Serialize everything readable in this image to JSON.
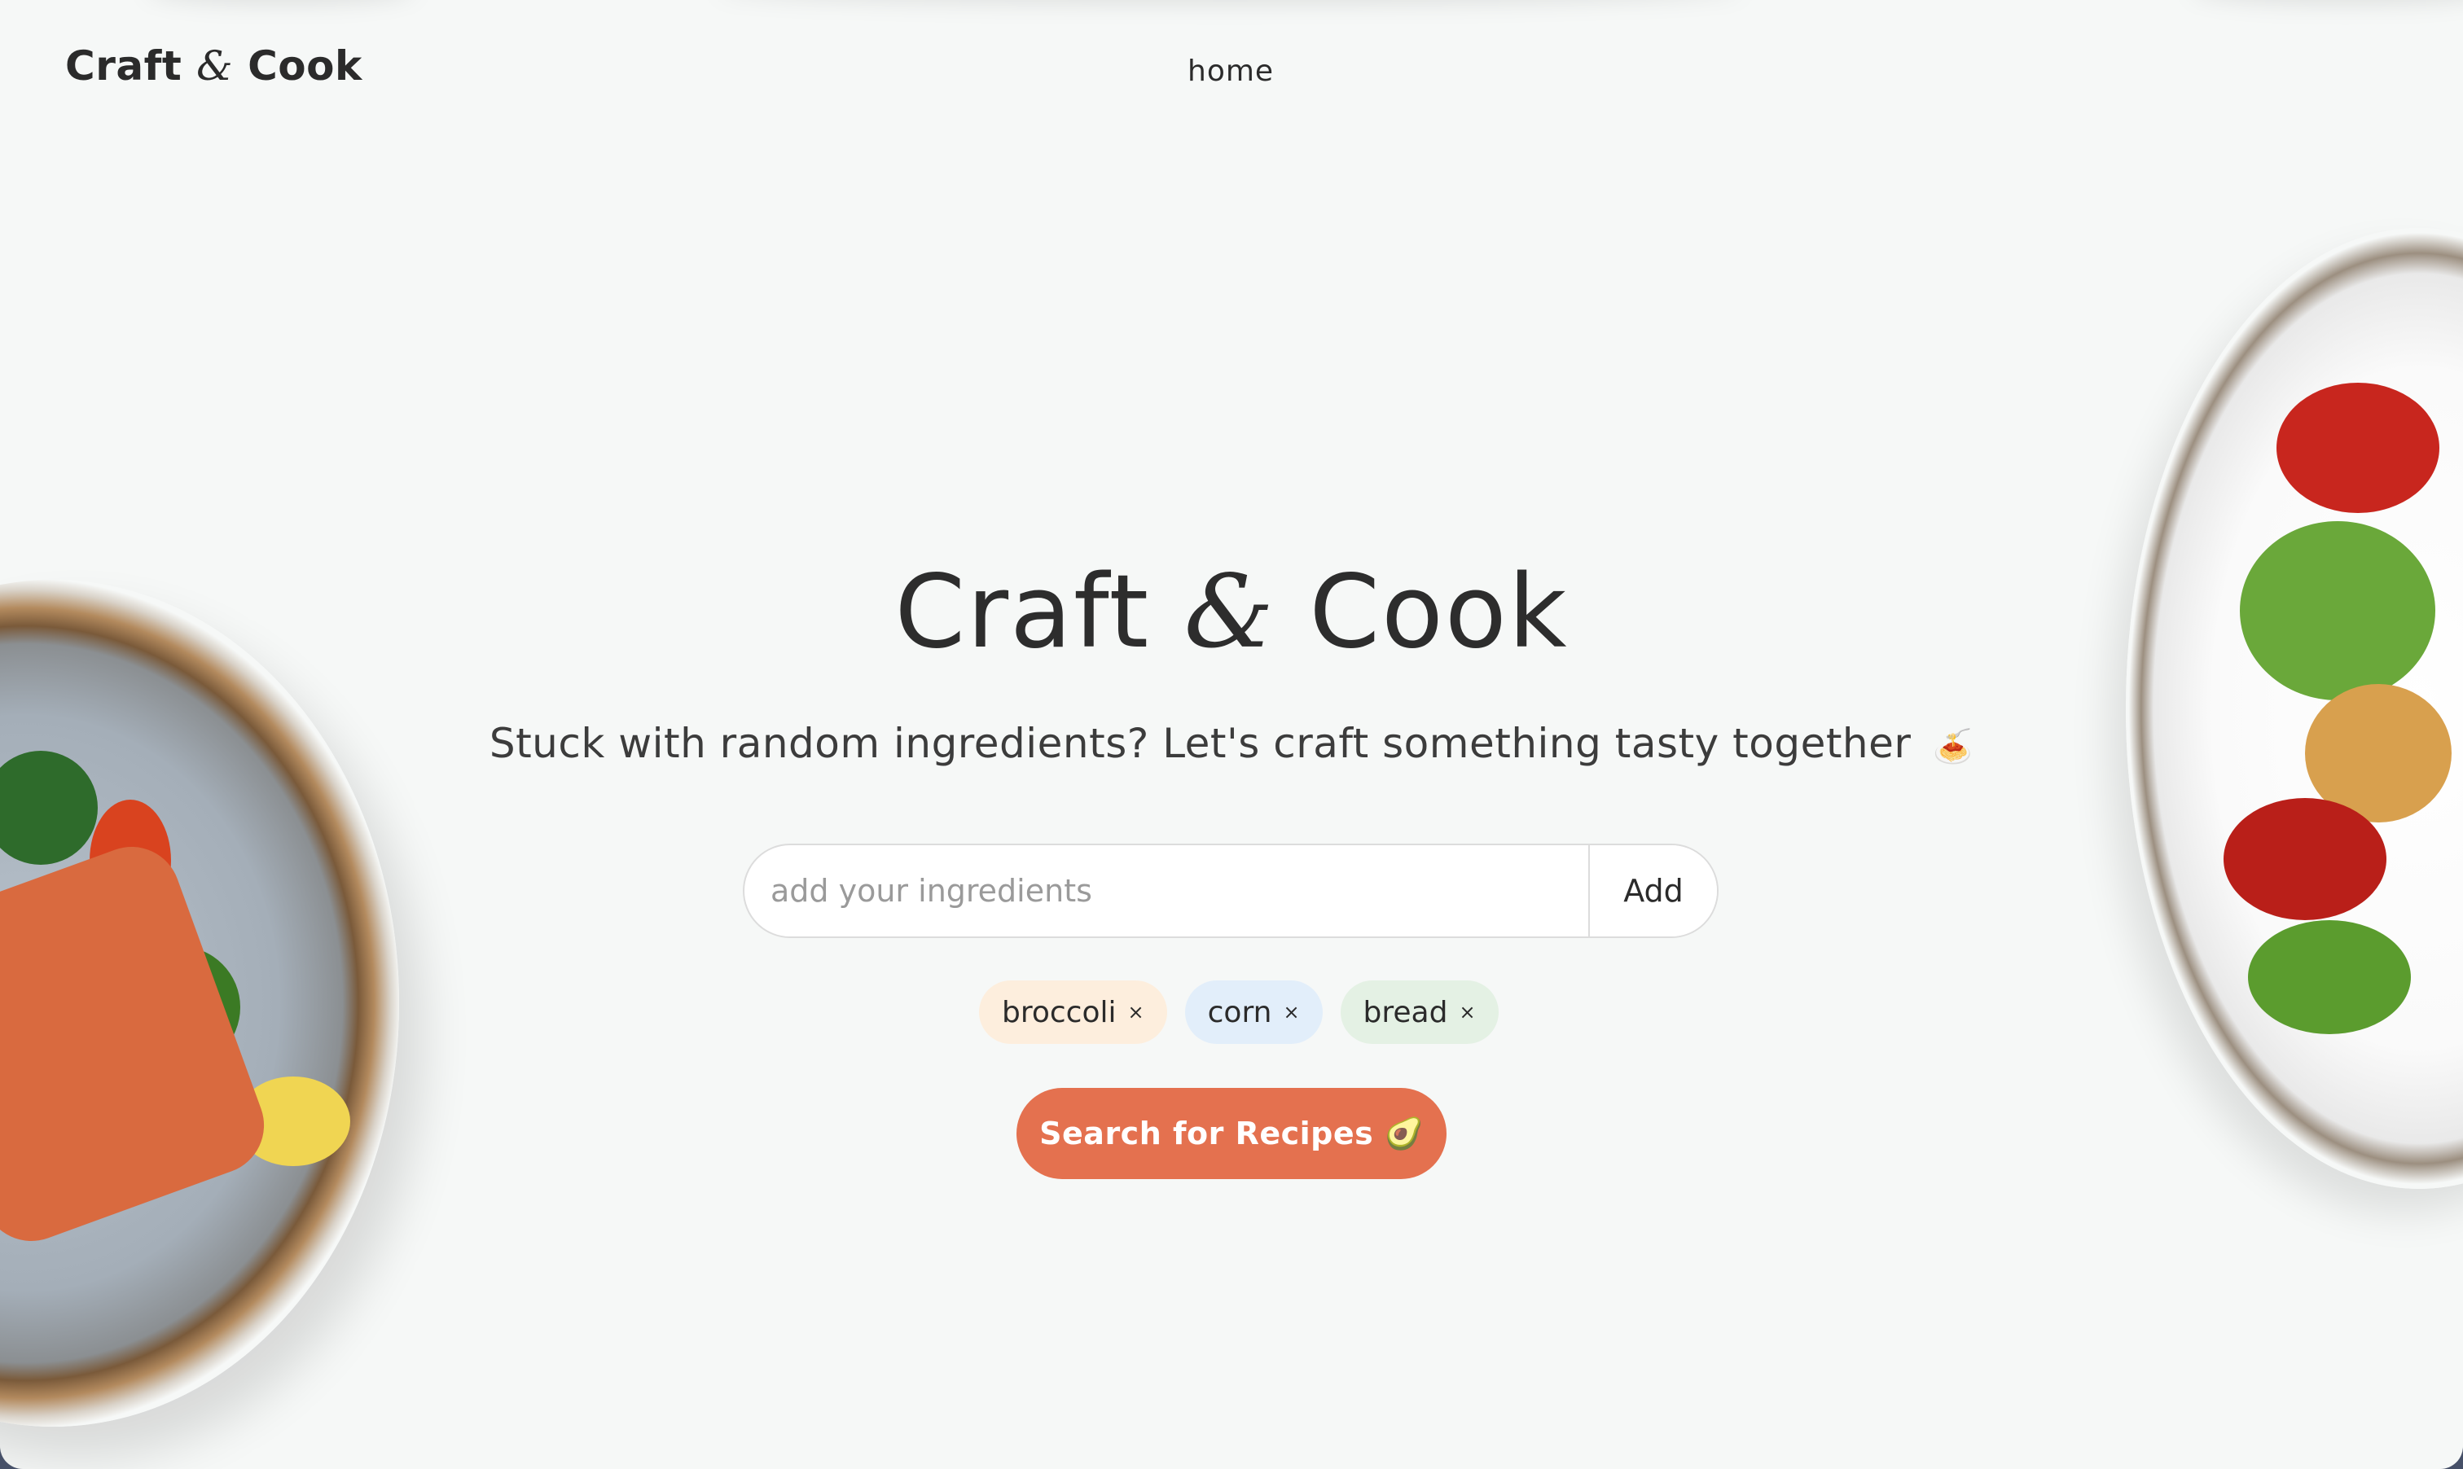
{
  "brand": {
    "name_left": "Craft",
    "amp": "&",
    "name_right": "Cook"
  },
  "nav": {
    "home": "home"
  },
  "hero": {
    "title_left": "Craft",
    "title_amp": "&",
    "title_right": "Cook",
    "subtitle": "Stuck with random ingredients? Let's craft something tasty together",
    "subtitle_emoji": "🍝"
  },
  "search": {
    "placeholder": "add your ingredients",
    "value": "",
    "add_label": "Add"
  },
  "ingredients": [
    {
      "label": "broccoli",
      "remove": "×",
      "color": "#fdeedd"
    },
    {
      "label": "corn",
      "remove": "×",
      "color": "#e2eefa"
    },
    {
      "label": "bread",
      "remove": "×",
      "color": "#e4f1e4"
    }
  ],
  "cta": {
    "label": "Search for Recipes 🥑"
  },
  "colors": {
    "accent": "#e4714f",
    "background": "#f6f8f7",
    "text": "#2b2b2b"
  }
}
